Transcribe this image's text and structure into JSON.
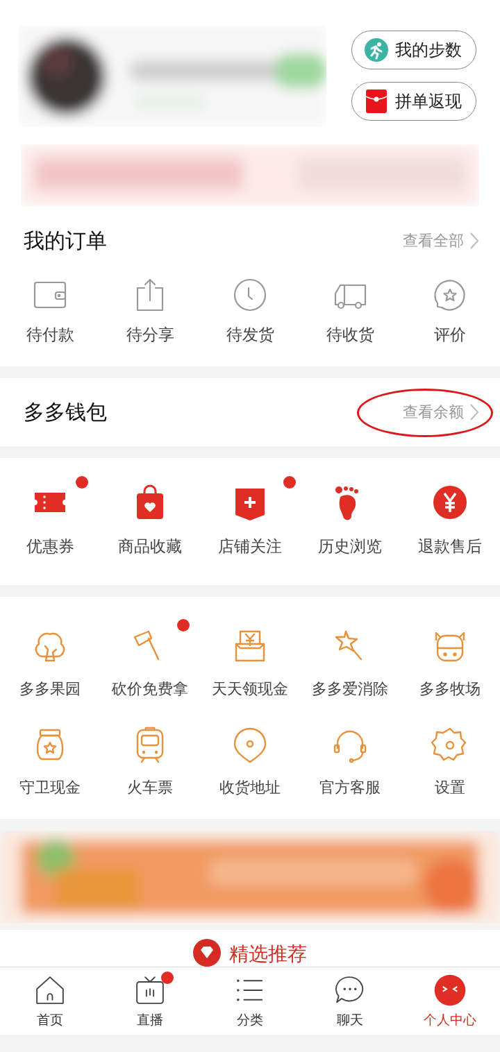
{
  "header": {
    "buttons": [
      {
        "label": "我的步数",
        "kind": "steps"
      },
      {
        "label": "拼单返现",
        "kind": "cashback"
      }
    ]
  },
  "orders": {
    "title": "我的订单",
    "link": "查看全部",
    "items": [
      {
        "label": "待付款"
      },
      {
        "label": "待分享"
      },
      {
        "label": "待发货"
      },
      {
        "label": "待收货"
      },
      {
        "label": "评价"
      }
    ]
  },
  "wallet": {
    "title": "多多钱包",
    "link": "查看余额",
    "highlighted": true
  },
  "shortcuts": [
    {
      "label": "优惠券",
      "badge": true
    },
    {
      "label": "商品收藏",
      "badge": false
    },
    {
      "label": "店铺关注",
      "badge": true
    },
    {
      "label": "历史浏览",
      "badge": false
    },
    {
      "label": "退款售后",
      "badge": false
    }
  ],
  "services": [
    {
      "label": "多多果园",
      "badge": false
    },
    {
      "label": "砍价免费拿",
      "badge": true
    },
    {
      "label": "天天领现金",
      "badge": false
    },
    {
      "label": "多多爱消除",
      "badge": false
    },
    {
      "label": "多多牧场",
      "badge": false
    },
    {
      "label": "守卫现金",
      "badge": false
    },
    {
      "label": "火车票",
      "badge": false
    },
    {
      "label": "收货地址",
      "badge": false
    },
    {
      "label": "官方客服",
      "badge": false
    },
    {
      "label": "设置",
      "badge": false
    }
  ],
  "recommend": {
    "title": "精选推荐"
  },
  "tab_bar": [
    {
      "label": "首页",
      "selected": false,
      "badge": false
    },
    {
      "label": "直播",
      "selected": false,
      "badge": true
    },
    {
      "label": "分类",
      "selected": false,
      "badge": false
    },
    {
      "label": "聊天",
      "selected": false,
      "badge": false
    },
    {
      "label": "个人中心",
      "selected": true,
      "badge": false
    }
  ]
}
